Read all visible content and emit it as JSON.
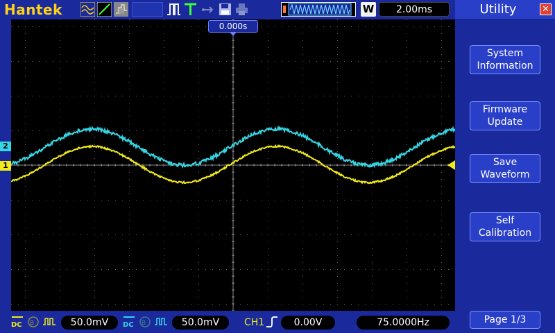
{
  "brand": "Hantek",
  "topbar": {
    "w_label": "W",
    "timebase": "2.00ms",
    "icons": [
      "wave-mode-icon",
      "ramp-icon",
      "gray-mode-icon",
      "pulse-icon",
      "trigger-t-icon",
      "arrow-usb-icon",
      "save-disk-icon",
      "printer-icon",
      "horizontal-window-icon"
    ]
  },
  "screen": {
    "trigger_time": "0.000s",
    "ch1_marker": "1",
    "ch2_marker": "2",
    "colors": {
      "ch1": "#f0ea1a",
      "ch2": "#34d6e4",
      "grid": "#6a6a6a"
    }
  },
  "panel": {
    "title": "Utility",
    "close": "✕",
    "buttons": [
      {
        "line1": "System",
        "line2": "Information"
      },
      {
        "line1": "Firmware",
        "line2": "Update"
      },
      {
        "line1": "Save",
        "line2": "Waveform"
      },
      {
        "line1": "Self",
        "line2": "Calibration"
      }
    ],
    "page": "Page 1/3"
  },
  "bottombar": {
    "ch1_coupling": "DC",
    "ch1_scale": "50.0mV",
    "ch2_coupling": "DC",
    "ch2_scale": "50.0mV",
    "trigger_source": "CH1",
    "trigger_level": "0.00V",
    "frequency": "75.0000Hz"
  }
}
